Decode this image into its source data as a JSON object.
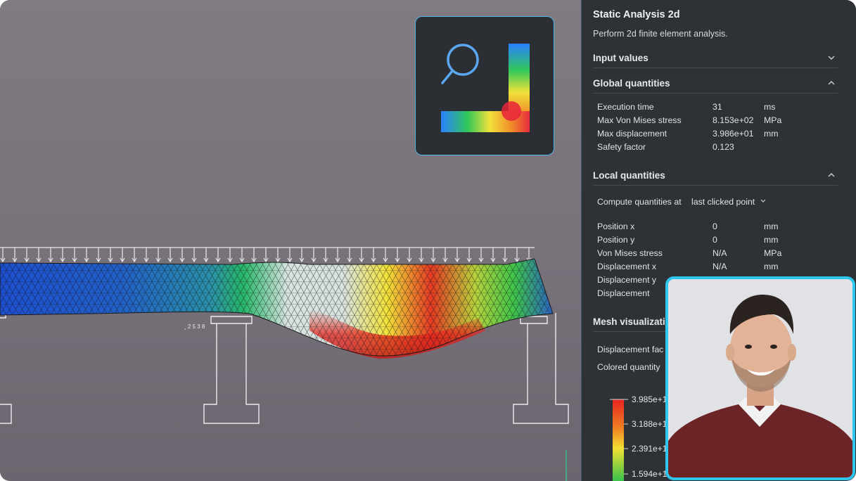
{
  "panel": {
    "title": "Static Analysis 2d",
    "description": "Perform 2d finite element analysis.",
    "sections": {
      "input_values": "Input values",
      "global_quantities": "Global quantities",
      "local_quantities": "Local quantities",
      "mesh_visualization": "Mesh visualizatio"
    },
    "global": [
      {
        "label": "Execution time",
        "value": "31",
        "unit": "ms"
      },
      {
        "label": "Max Von Mises stress",
        "value": "8.153e+02",
        "unit": "MPa"
      },
      {
        "label": "Max displacement",
        "value": "3.986e+01",
        "unit": "mm"
      },
      {
        "label": "Safety factor",
        "value": "0.123",
        "unit": ""
      }
    ],
    "compute_label": "Compute quantities at",
    "compute_value": "last clicked point",
    "local": [
      {
        "label": "Position x",
        "value": "0",
        "unit": "mm"
      },
      {
        "label": "Position y",
        "value": "0",
        "unit": "mm"
      },
      {
        "label": "Von Mises stress",
        "value": "N/A",
        "unit": "MPa"
      },
      {
        "label": "Displacement x",
        "value": "N/A",
        "unit": "mm"
      },
      {
        "label": "Displacement y",
        "value": "",
        "unit": ""
      },
      {
        "label": "Displacement",
        "value": "",
        "unit": ""
      }
    ],
    "mesh": {
      "displacement_factor_label": "Displacement fac",
      "colored_quantity_label": "Colored quantity"
    },
    "legend_ticks": [
      "3.985e+1",
      "3.188e+1",
      "2.391e+1",
      "1.594e+1"
    ]
  },
  "viewport": {
    "drawing_label": "¸ 2 5 3 8"
  },
  "icons": [
    "magnifier-icon",
    "chevron-down-icon",
    "chevron-up-icon"
  ],
  "colors": {
    "panel_bg": "#2e3236",
    "viewport_bg": "#77717a",
    "accent": "#4fb3e8",
    "webcam_border": "#2ec6ef"
  }
}
